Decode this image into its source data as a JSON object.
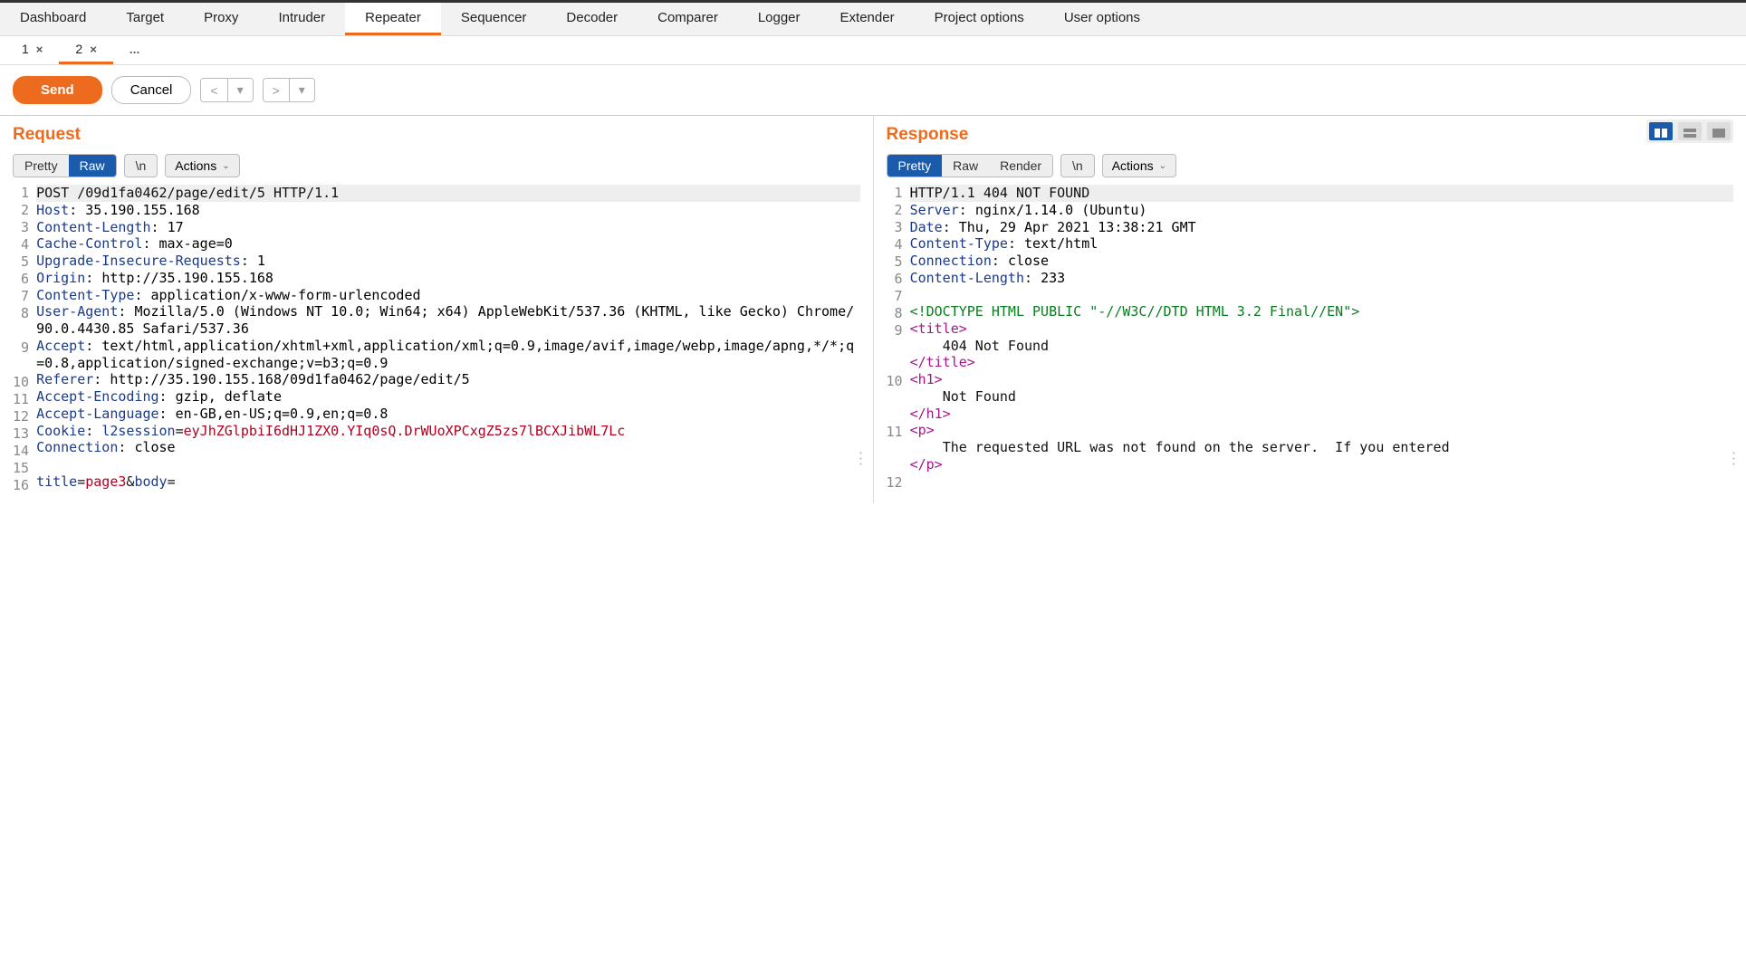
{
  "main_tabs": [
    "Dashboard",
    "Target",
    "Proxy",
    "Intruder",
    "Repeater",
    "Sequencer",
    "Decoder",
    "Comparer",
    "Logger",
    "Extender",
    "Project options",
    "User options"
  ],
  "main_tabs_active": 4,
  "sub_tabs": [
    {
      "label": "1",
      "closable": true
    },
    {
      "label": "2",
      "closable": true
    }
  ],
  "sub_tabs_active": 1,
  "sub_tabs_more": "...",
  "actions": {
    "send": "Send",
    "cancel": "Cancel",
    "prev": "<",
    "next": ">",
    "dd": "▾"
  },
  "request": {
    "title": "Request",
    "views": [
      "Pretty",
      "Raw"
    ],
    "view_active": 1,
    "newline_btn": "\\n",
    "actions_label": "Actions",
    "lines": [
      {
        "n": 1,
        "hl": true,
        "segs": [
          {
            "c": "txt",
            "t": "POST /09d1fa0462/page/edit/5 HTTP/1.1"
          }
        ]
      },
      {
        "n": 2,
        "segs": [
          {
            "c": "hn",
            "t": "Host"
          },
          {
            "c": "txt",
            "t": ": "
          },
          {
            "c": "hv",
            "t": "35.190.155.168"
          }
        ]
      },
      {
        "n": 3,
        "segs": [
          {
            "c": "hn",
            "t": "Content-Length"
          },
          {
            "c": "txt",
            "t": ": "
          },
          {
            "c": "hv",
            "t": "17"
          }
        ]
      },
      {
        "n": 4,
        "segs": [
          {
            "c": "hn",
            "t": "Cache-Control"
          },
          {
            "c": "txt",
            "t": ": "
          },
          {
            "c": "hv",
            "t": "max-age=0"
          }
        ]
      },
      {
        "n": 5,
        "segs": [
          {
            "c": "hn",
            "t": "Upgrade-Insecure-Requests"
          },
          {
            "c": "txt",
            "t": ": "
          },
          {
            "c": "hv",
            "t": "1"
          }
        ]
      },
      {
        "n": 6,
        "segs": [
          {
            "c": "hn",
            "t": "Origin"
          },
          {
            "c": "txt",
            "t": ": "
          },
          {
            "c": "hv",
            "t": "http://35.190.155.168"
          }
        ]
      },
      {
        "n": 7,
        "segs": [
          {
            "c": "hn",
            "t": "Content-Type"
          },
          {
            "c": "txt",
            "t": ": "
          },
          {
            "c": "hv",
            "t": "application/x-www-form-urlencoded"
          }
        ]
      },
      {
        "n": 8,
        "segs": [
          {
            "c": "hn",
            "t": "User-Agent"
          },
          {
            "c": "txt",
            "t": ": "
          },
          {
            "c": "hv",
            "t": "Mozilla/5.0 (Windows NT 10.0; Win64; x64) AppleWebKit/537.36 (KHTML, like Gecko) Chrome/90.0.4430.85 Safari/537.36"
          }
        ]
      },
      {
        "n": 9,
        "segs": [
          {
            "c": "hn",
            "t": "Accept"
          },
          {
            "c": "txt",
            "t": ": "
          },
          {
            "c": "hv",
            "t": "text/html,application/xhtml+xml,application/xml;q=0.9,image/avif,image/webp,image/apng,*/*;q=0.8,application/signed-exchange;v=b3;q=0.9"
          }
        ]
      },
      {
        "n": 10,
        "segs": [
          {
            "c": "hn",
            "t": "Referer"
          },
          {
            "c": "txt",
            "t": ": "
          },
          {
            "c": "hv",
            "t": "http://35.190.155.168/09d1fa0462/page/edit/5"
          }
        ]
      },
      {
        "n": 11,
        "segs": [
          {
            "c": "hn",
            "t": "Accept-Encoding"
          },
          {
            "c": "txt",
            "t": ": "
          },
          {
            "c": "hv",
            "t": "gzip, deflate"
          }
        ]
      },
      {
        "n": 12,
        "segs": [
          {
            "c": "hn",
            "t": "Accept-Language"
          },
          {
            "c": "txt",
            "t": ": "
          },
          {
            "c": "hv",
            "t": "en-GB,en-US;q=0.9,en;q=0.8"
          }
        ]
      },
      {
        "n": 13,
        "segs": [
          {
            "c": "hn",
            "t": "Cookie"
          },
          {
            "c": "txt",
            "t": ": "
          },
          {
            "c": "hn",
            "t": "l2session"
          },
          {
            "c": "txt",
            "t": "="
          },
          {
            "c": "ck",
            "t": "eyJhZGlpbiI6dHJ1ZX0.YIq0sQ.DrWUoXPCxgZ5zs7lBCXJibWL7Lc"
          }
        ]
      },
      {
        "n": 14,
        "segs": [
          {
            "c": "hn",
            "t": "Connection"
          },
          {
            "c": "txt",
            "t": ": "
          },
          {
            "c": "hv",
            "t": "close"
          }
        ]
      },
      {
        "n": 15,
        "segs": [
          {
            "c": "txt",
            "t": ""
          }
        ]
      },
      {
        "n": 16,
        "segs": [
          {
            "c": "pk",
            "t": "title"
          },
          {
            "c": "txt",
            "t": "="
          },
          {
            "c": "pv",
            "t": "page3"
          },
          {
            "c": "txt",
            "t": "&"
          },
          {
            "c": "pk",
            "t": "body"
          },
          {
            "c": "txt",
            "t": "="
          }
        ]
      }
    ]
  },
  "response": {
    "title": "Response",
    "views": [
      "Pretty",
      "Raw",
      "Render"
    ],
    "view_active": 0,
    "newline_btn": "\\n",
    "actions_label": "Actions",
    "lines": [
      {
        "n": 1,
        "hl": true,
        "segs": [
          {
            "c": "txt",
            "t": "HTTP/1.1 404 NOT FOUND"
          }
        ]
      },
      {
        "n": 2,
        "segs": [
          {
            "c": "hn",
            "t": "Server"
          },
          {
            "c": "txt",
            "t": ": "
          },
          {
            "c": "hv",
            "t": "nginx/1.14.0 (Ubuntu)"
          }
        ]
      },
      {
        "n": 3,
        "segs": [
          {
            "c": "hn",
            "t": "Date"
          },
          {
            "c": "txt",
            "t": ": "
          },
          {
            "c": "hv",
            "t": "Thu, 29 Apr 2021 13:38:21 GMT"
          }
        ]
      },
      {
        "n": 4,
        "segs": [
          {
            "c": "hn",
            "t": "Content-Type"
          },
          {
            "c": "txt",
            "t": ": "
          },
          {
            "c": "hv",
            "t": "text/html"
          }
        ]
      },
      {
        "n": 5,
        "segs": [
          {
            "c": "hn",
            "t": "Connection"
          },
          {
            "c": "txt",
            "t": ": "
          },
          {
            "c": "hv",
            "t": "close"
          }
        ]
      },
      {
        "n": 6,
        "segs": [
          {
            "c": "hn",
            "t": "Content-Length"
          },
          {
            "c": "txt",
            "t": ": "
          },
          {
            "c": "hv",
            "t": "233"
          }
        ]
      },
      {
        "n": 7,
        "segs": [
          {
            "c": "txt",
            "t": ""
          }
        ]
      },
      {
        "n": 8,
        "segs": [
          {
            "c": "doct",
            "t": "<!DOCTYPE HTML PUBLIC \"-//W3C//DTD HTML 3.2 Final//EN\">"
          }
        ]
      },
      {
        "n": 9,
        "segs": [
          {
            "c": "tag",
            "t": "<title>"
          },
          {
            "c": "txt",
            "t": "\n    404 Not Found\n"
          },
          {
            "c": "tag",
            "t": "</title>"
          }
        ]
      },
      {
        "n": 10,
        "segs": [
          {
            "c": "tag",
            "t": "<h1>"
          },
          {
            "c": "txt",
            "t": "\n    Not Found\n"
          },
          {
            "c": "tag",
            "t": "</h1>"
          }
        ]
      },
      {
        "n": 11,
        "segs": [
          {
            "c": "tag",
            "t": "<p>"
          },
          {
            "c": "txt",
            "t": "\n    The requested URL was not found on the server.  If you entered\n"
          },
          {
            "c": "tag",
            "t": "</p>"
          }
        ]
      },
      {
        "n": 12,
        "segs": [
          {
            "c": "txt",
            "t": ""
          }
        ]
      }
    ]
  }
}
